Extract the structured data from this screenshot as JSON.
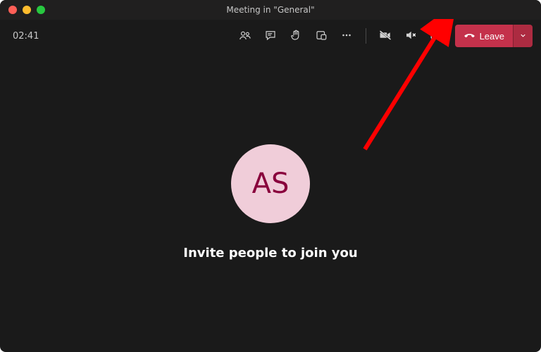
{
  "titlebar": {
    "title": "Meeting in \"General\""
  },
  "toolbar": {
    "timer": "02:41",
    "leave_label": "Leave"
  },
  "stage": {
    "avatar_initials": "AS",
    "invite_text": "Invite people to join you"
  },
  "colors": {
    "accent_leave": "#c4314b",
    "avatar_bg": "#f0cdd9",
    "avatar_fg": "#89003c",
    "annotation_arrow": "#ff0000"
  }
}
